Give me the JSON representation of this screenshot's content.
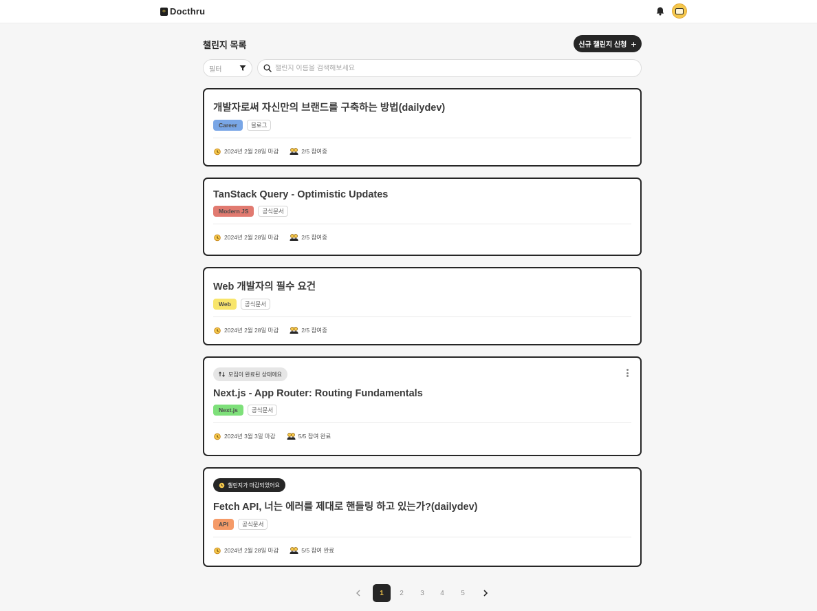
{
  "header": {
    "logo_mark": "‹›",
    "logo_text": "Docthru"
  },
  "page": {
    "title": "챌린지 목록",
    "new_button": "신규 챌린지 신청",
    "new_button_icon": "+"
  },
  "filter": {
    "label": "필터"
  },
  "search": {
    "placeholder": "챌린지 이름을 검색해보세요"
  },
  "challenges": [
    {
      "title": "개발자로써 자신만의 브랜드를 구축하는 방법(dailydev)",
      "category": "Career",
      "category_color": "#79a6e6",
      "doc_type": "블로그",
      "deadline": "2024년 2월 28일 마감",
      "participants": "2/5 참여중"
    },
    {
      "title": "TanStack Query - Optimistic Updates",
      "category": "Modern JS",
      "category_color": "#e17a70",
      "doc_type": "공식문서",
      "deadline": "2024년 2월 28일 마감",
      "participants": "2/5 참여중"
    },
    {
      "title": "Web 개발자의 필수 요건",
      "category": "Web",
      "category_color": "#f8e56b",
      "doc_type": "공식문서",
      "deadline": "2024년 2월 28일 마감",
      "participants": "2/5 참여중"
    },
    {
      "status": "모집이 완료된 상태에요",
      "title": "Next.js - App Router: Routing Fundamentals",
      "category": "Next.js",
      "category_color": "#7ee07a",
      "doc_type": "공식문서",
      "deadline": "2024년 3월 3일 마감",
      "participants": "5/5 참여 완료"
    },
    {
      "status": "챌린지가 마감되었어요",
      "title": "Fetch API, 너는 에러를 제대로 핸들링 하고 있는가?(dailydev)",
      "category": "API",
      "category_color": "#f59a67",
      "doc_type": "공식문서",
      "deadline": "2024년 2월 28일 마감",
      "participants": "5/5 참여 완료"
    }
  ],
  "pagination": {
    "pages": [
      "1",
      "2",
      "3",
      "4",
      "5"
    ],
    "current": "1",
    "prev_icon": "chevron-left-icon",
    "next_icon": "chevron-right-icon"
  },
  "colors": {
    "accent_dark": "#262626",
    "brand_yellow": "#f5c84c",
    "background": "#f6f6f6"
  }
}
